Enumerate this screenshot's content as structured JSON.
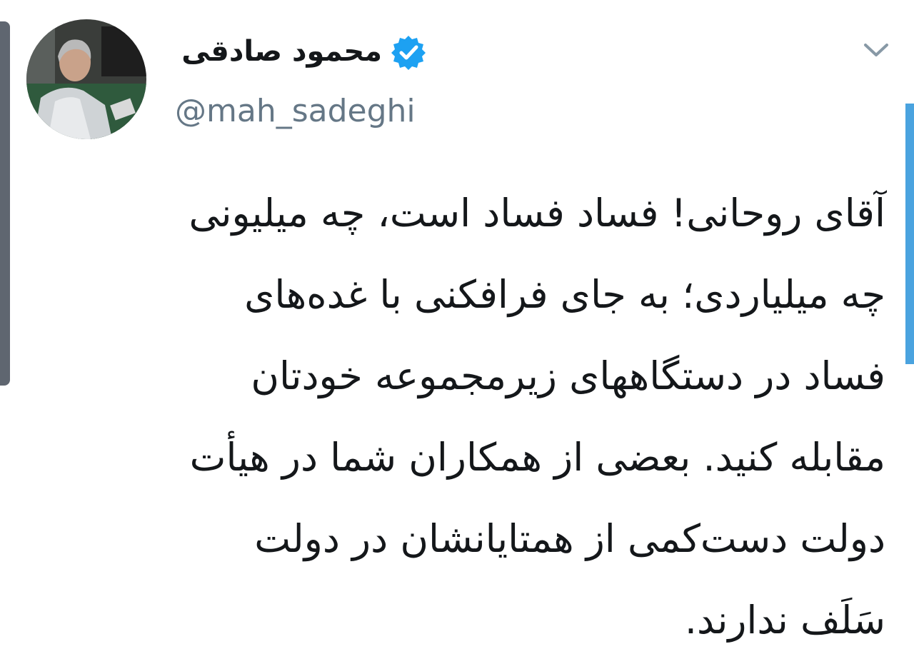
{
  "author": {
    "display_name": "محمود صادقی",
    "handle": "@mah_sadeghi",
    "verified": true
  },
  "tweet": {
    "lines": [
      "آقای روحانی! فساد فساد است، چه میلیونی",
      "چه میلیاردی؛ به جای فرافکنی با غده‌های",
      "فساد در دستگاههای زیرمجموعه خودتان",
      "مقابله کنید. بعضی از همکاران شما در هیأت",
      "دولت دست‌کمی از همتایانشان در دولت",
      "سَلَف ندارند."
    ]
  },
  "icons": {
    "verified": "verified-badge-icon",
    "menu": "chevron-down-icon"
  },
  "colors": {
    "verified_blue": "#1da1f2",
    "handle_gray": "#657786",
    "text_dark": "#14171a"
  }
}
